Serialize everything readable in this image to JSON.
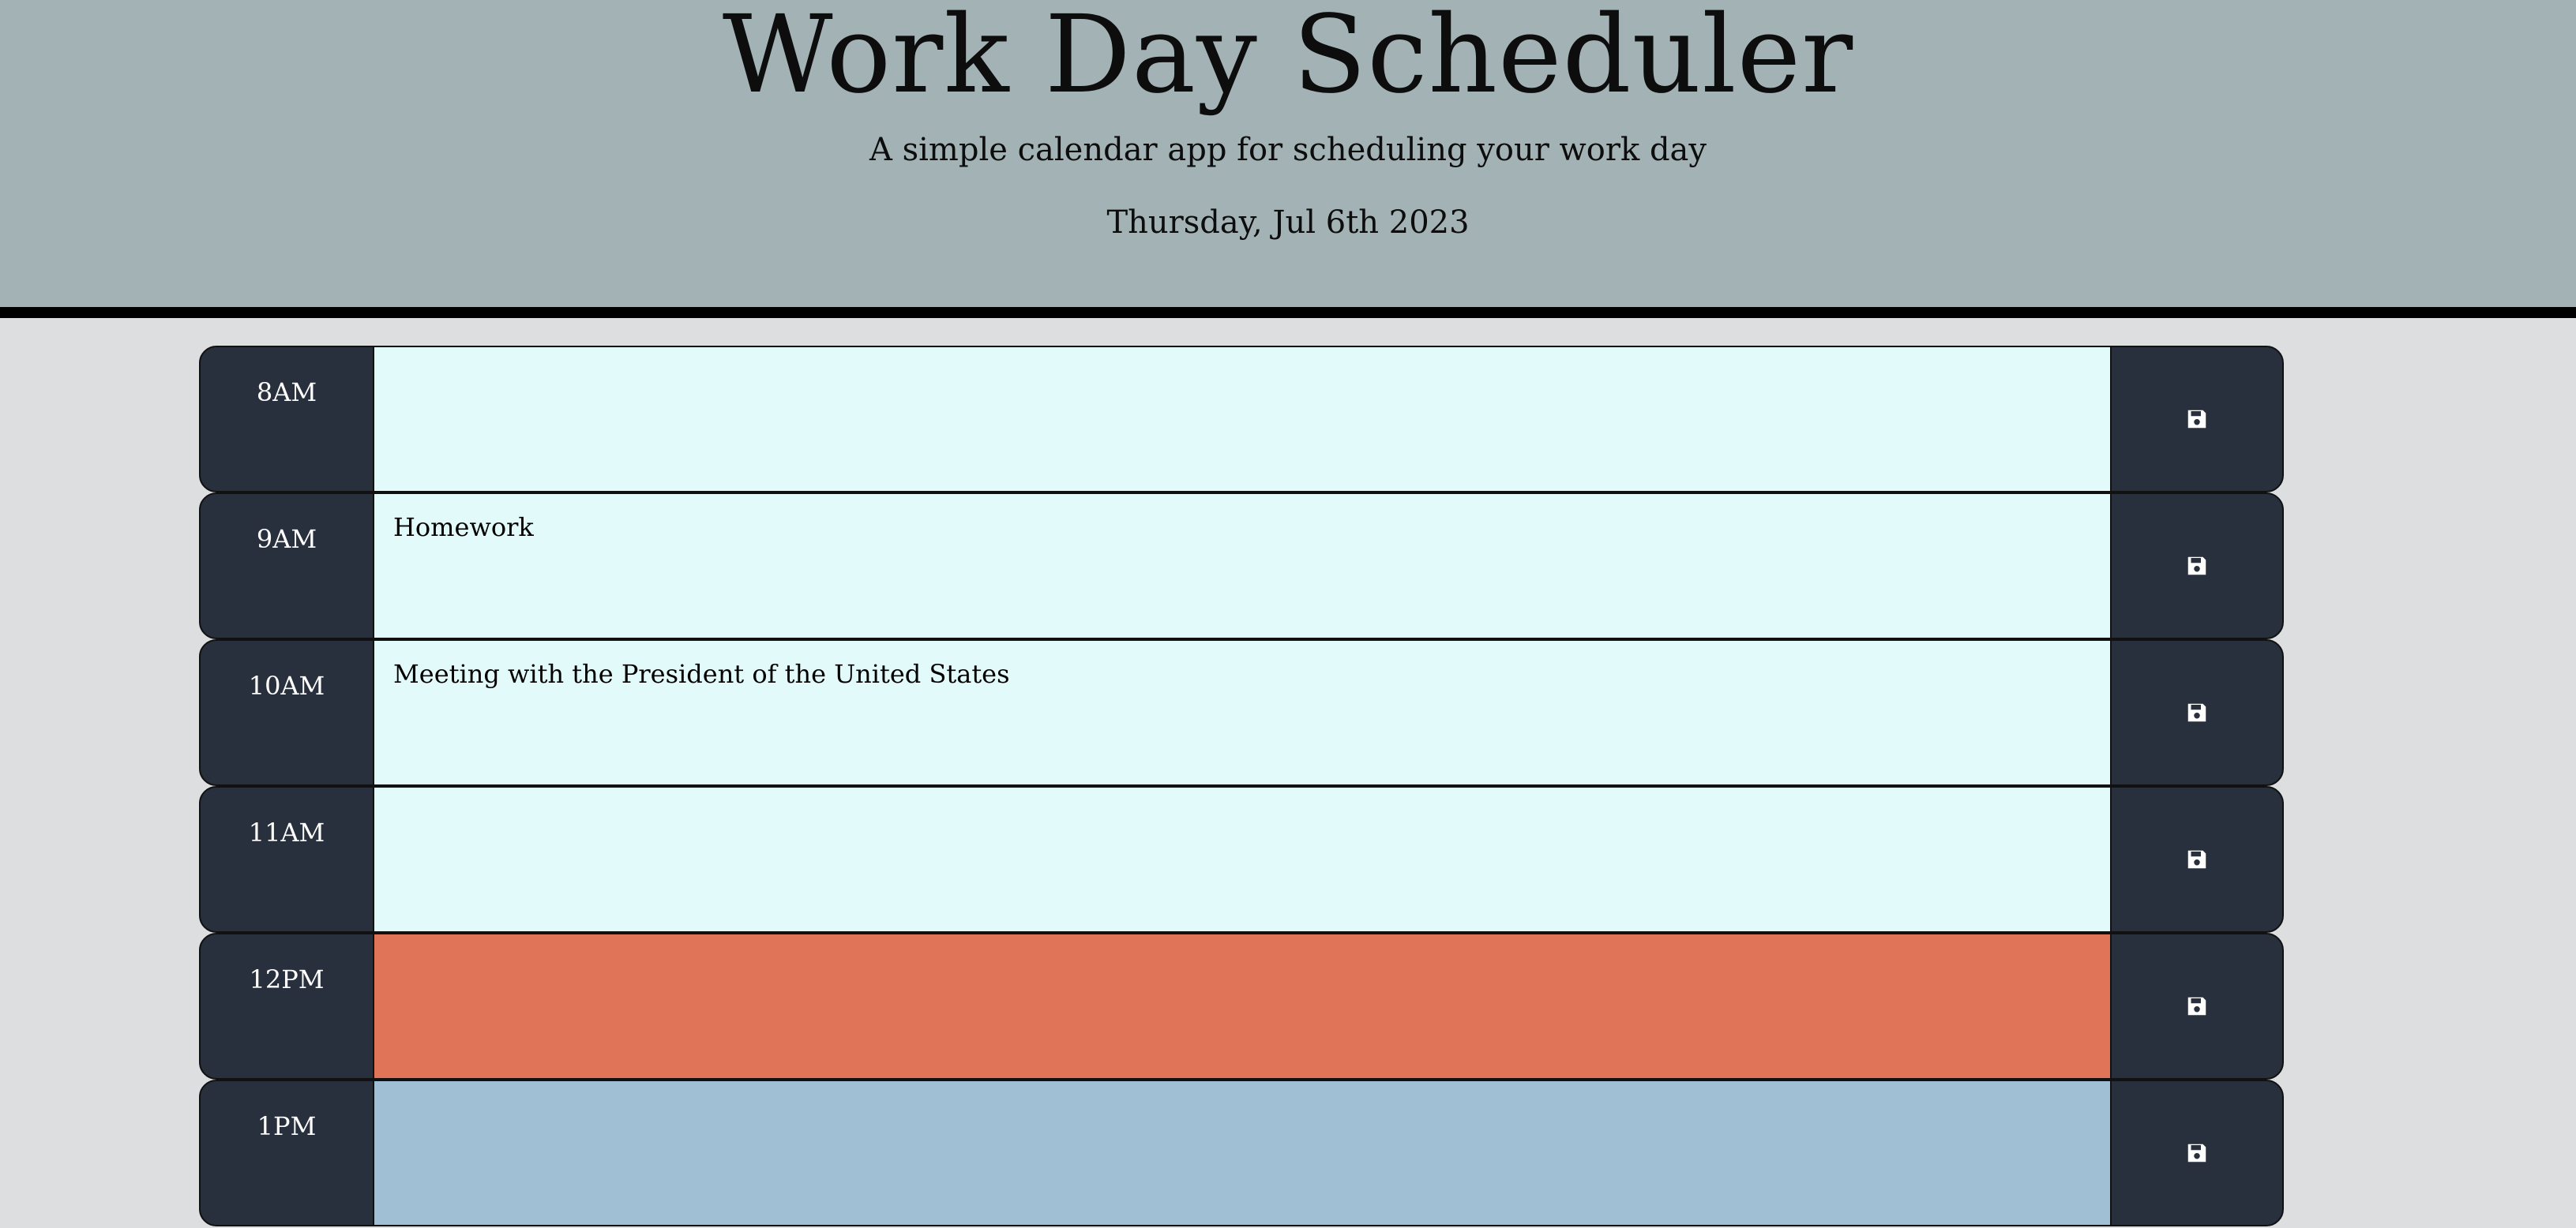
{
  "header": {
    "title": "Work Day Scheduler",
    "subtitle": "A simple calendar app for scheduling your work day",
    "date": "Thursday, Jul 6th 2023"
  },
  "colors": {
    "header_bg": "#a3b2b4",
    "page_bg": "#dddee0",
    "hour_bg": "#282f3d",
    "future": "#e2fafa",
    "present": "#df7459",
    "past": "#a0bfd4"
  },
  "rows": [
    {
      "hour": "8AM",
      "text": "",
      "state": "future"
    },
    {
      "hour": "9AM",
      "text": "Homework",
      "state": "future"
    },
    {
      "hour": "10AM",
      "text": "Meeting with the President of the United States",
      "state": "future"
    },
    {
      "hour": "11AM",
      "text": "",
      "state": "future"
    },
    {
      "hour": "12PM",
      "text": "",
      "state": "present"
    },
    {
      "hour": "1PM",
      "text": "",
      "state": "past"
    }
  ],
  "save_icon": "floppy-disk-icon"
}
